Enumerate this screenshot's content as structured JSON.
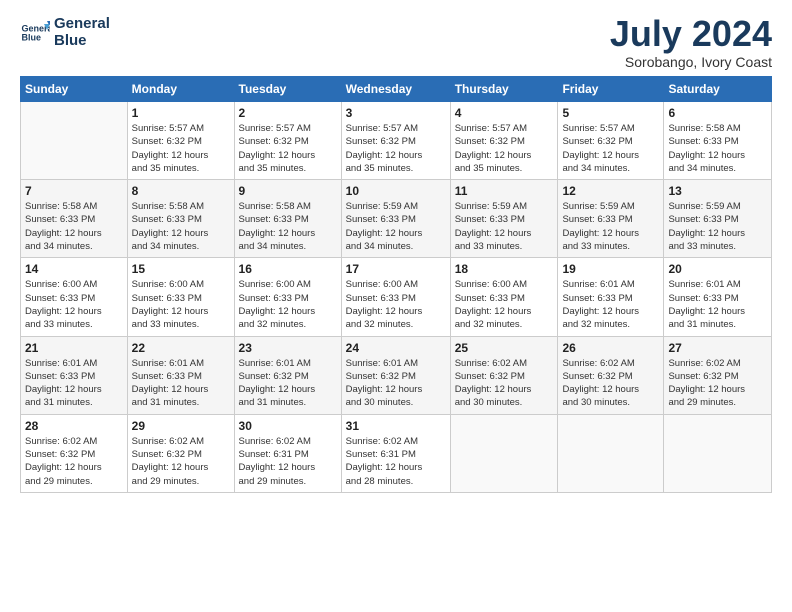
{
  "header": {
    "logo_line1": "General",
    "logo_line2": "Blue",
    "month": "July 2024",
    "location": "Sorobango, Ivory Coast"
  },
  "weekdays": [
    "Sunday",
    "Monday",
    "Tuesday",
    "Wednesday",
    "Thursday",
    "Friday",
    "Saturday"
  ],
  "weeks": [
    [
      {
        "day": "",
        "info": ""
      },
      {
        "day": "1",
        "info": "Sunrise: 5:57 AM\nSunset: 6:32 PM\nDaylight: 12 hours\nand 35 minutes."
      },
      {
        "day": "2",
        "info": "Sunrise: 5:57 AM\nSunset: 6:32 PM\nDaylight: 12 hours\nand 35 minutes."
      },
      {
        "day": "3",
        "info": "Sunrise: 5:57 AM\nSunset: 6:32 PM\nDaylight: 12 hours\nand 35 minutes."
      },
      {
        "day": "4",
        "info": "Sunrise: 5:57 AM\nSunset: 6:32 PM\nDaylight: 12 hours\nand 35 minutes."
      },
      {
        "day": "5",
        "info": "Sunrise: 5:57 AM\nSunset: 6:32 PM\nDaylight: 12 hours\nand 34 minutes."
      },
      {
        "day": "6",
        "info": "Sunrise: 5:58 AM\nSunset: 6:33 PM\nDaylight: 12 hours\nand 34 minutes."
      }
    ],
    [
      {
        "day": "7",
        "info": "Sunrise: 5:58 AM\nSunset: 6:33 PM\nDaylight: 12 hours\nand 34 minutes."
      },
      {
        "day": "8",
        "info": "Sunrise: 5:58 AM\nSunset: 6:33 PM\nDaylight: 12 hours\nand 34 minutes."
      },
      {
        "day": "9",
        "info": "Sunrise: 5:58 AM\nSunset: 6:33 PM\nDaylight: 12 hours\nand 34 minutes."
      },
      {
        "day": "10",
        "info": "Sunrise: 5:59 AM\nSunset: 6:33 PM\nDaylight: 12 hours\nand 34 minutes."
      },
      {
        "day": "11",
        "info": "Sunrise: 5:59 AM\nSunset: 6:33 PM\nDaylight: 12 hours\nand 33 minutes."
      },
      {
        "day": "12",
        "info": "Sunrise: 5:59 AM\nSunset: 6:33 PM\nDaylight: 12 hours\nand 33 minutes."
      },
      {
        "day": "13",
        "info": "Sunrise: 5:59 AM\nSunset: 6:33 PM\nDaylight: 12 hours\nand 33 minutes."
      }
    ],
    [
      {
        "day": "14",
        "info": "Sunrise: 6:00 AM\nSunset: 6:33 PM\nDaylight: 12 hours\nand 33 minutes."
      },
      {
        "day": "15",
        "info": "Sunrise: 6:00 AM\nSunset: 6:33 PM\nDaylight: 12 hours\nand 33 minutes."
      },
      {
        "day": "16",
        "info": "Sunrise: 6:00 AM\nSunset: 6:33 PM\nDaylight: 12 hours\nand 32 minutes."
      },
      {
        "day": "17",
        "info": "Sunrise: 6:00 AM\nSunset: 6:33 PM\nDaylight: 12 hours\nand 32 minutes."
      },
      {
        "day": "18",
        "info": "Sunrise: 6:00 AM\nSunset: 6:33 PM\nDaylight: 12 hours\nand 32 minutes."
      },
      {
        "day": "19",
        "info": "Sunrise: 6:01 AM\nSunset: 6:33 PM\nDaylight: 12 hours\nand 32 minutes."
      },
      {
        "day": "20",
        "info": "Sunrise: 6:01 AM\nSunset: 6:33 PM\nDaylight: 12 hours\nand 31 minutes."
      }
    ],
    [
      {
        "day": "21",
        "info": "Sunrise: 6:01 AM\nSunset: 6:33 PM\nDaylight: 12 hours\nand 31 minutes."
      },
      {
        "day": "22",
        "info": "Sunrise: 6:01 AM\nSunset: 6:33 PM\nDaylight: 12 hours\nand 31 minutes."
      },
      {
        "day": "23",
        "info": "Sunrise: 6:01 AM\nSunset: 6:32 PM\nDaylight: 12 hours\nand 31 minutes."
      },
      {
        "day": "24",
        "info": "Sunrise: 6:01 AM\nSunset: 6:32 PM\nDaylight: 12 hours\nand 30 minutes."
      },
      {
        "day": "25",
        "info": "Sunrise: 6:02 AM\nSunset: 6:32 PM\nDaylight: 12 hours\nand 30 minutes."
      },
      {
        "day": "26",
        "info": "Sunrise: 6:02 AM\nSunset: 6:32 PM\nDaylight: 12 hours\nand 30 minutes."
      },
      {
        "day": "27",
        "info": "Sunrise: 6:02 AM\nSunset: 6:32 PM\nDaylight: 12 hours\nand 29 minutes."
      }
    ],
    [
      {
        "day": "28",
        "info": "Sunrise: 6:02 AM\nSunset: 6:32 PM\nDaylight: 12 hours\nand 29 minutes."
      },
      {
        "day": "29",
        "info": "Sunrise: 6:02 AM\nSunset: 6:32 PM\nDaylight: 12 hours\nand 29 minutes."
      },
      {
        "day": "30",
        "info": "Sunrise: 6:02 AM\nSunset: 6:31 PM\nDaylight: 12 hours\nand 29 minutes."
      },
      {
        "day": "31",
        "info": "Sunrise: 6:02 AM\nSunset: 6:31 PM\nDaylight: 12 hours\nand 28 minutes."
      },
      {
        "day": "",
        "info": ""
      },
      {
        "day": "",
        "info": ""
      },
      {
        "day": "",
        "info": ""
      }
    ]
  ]
}
